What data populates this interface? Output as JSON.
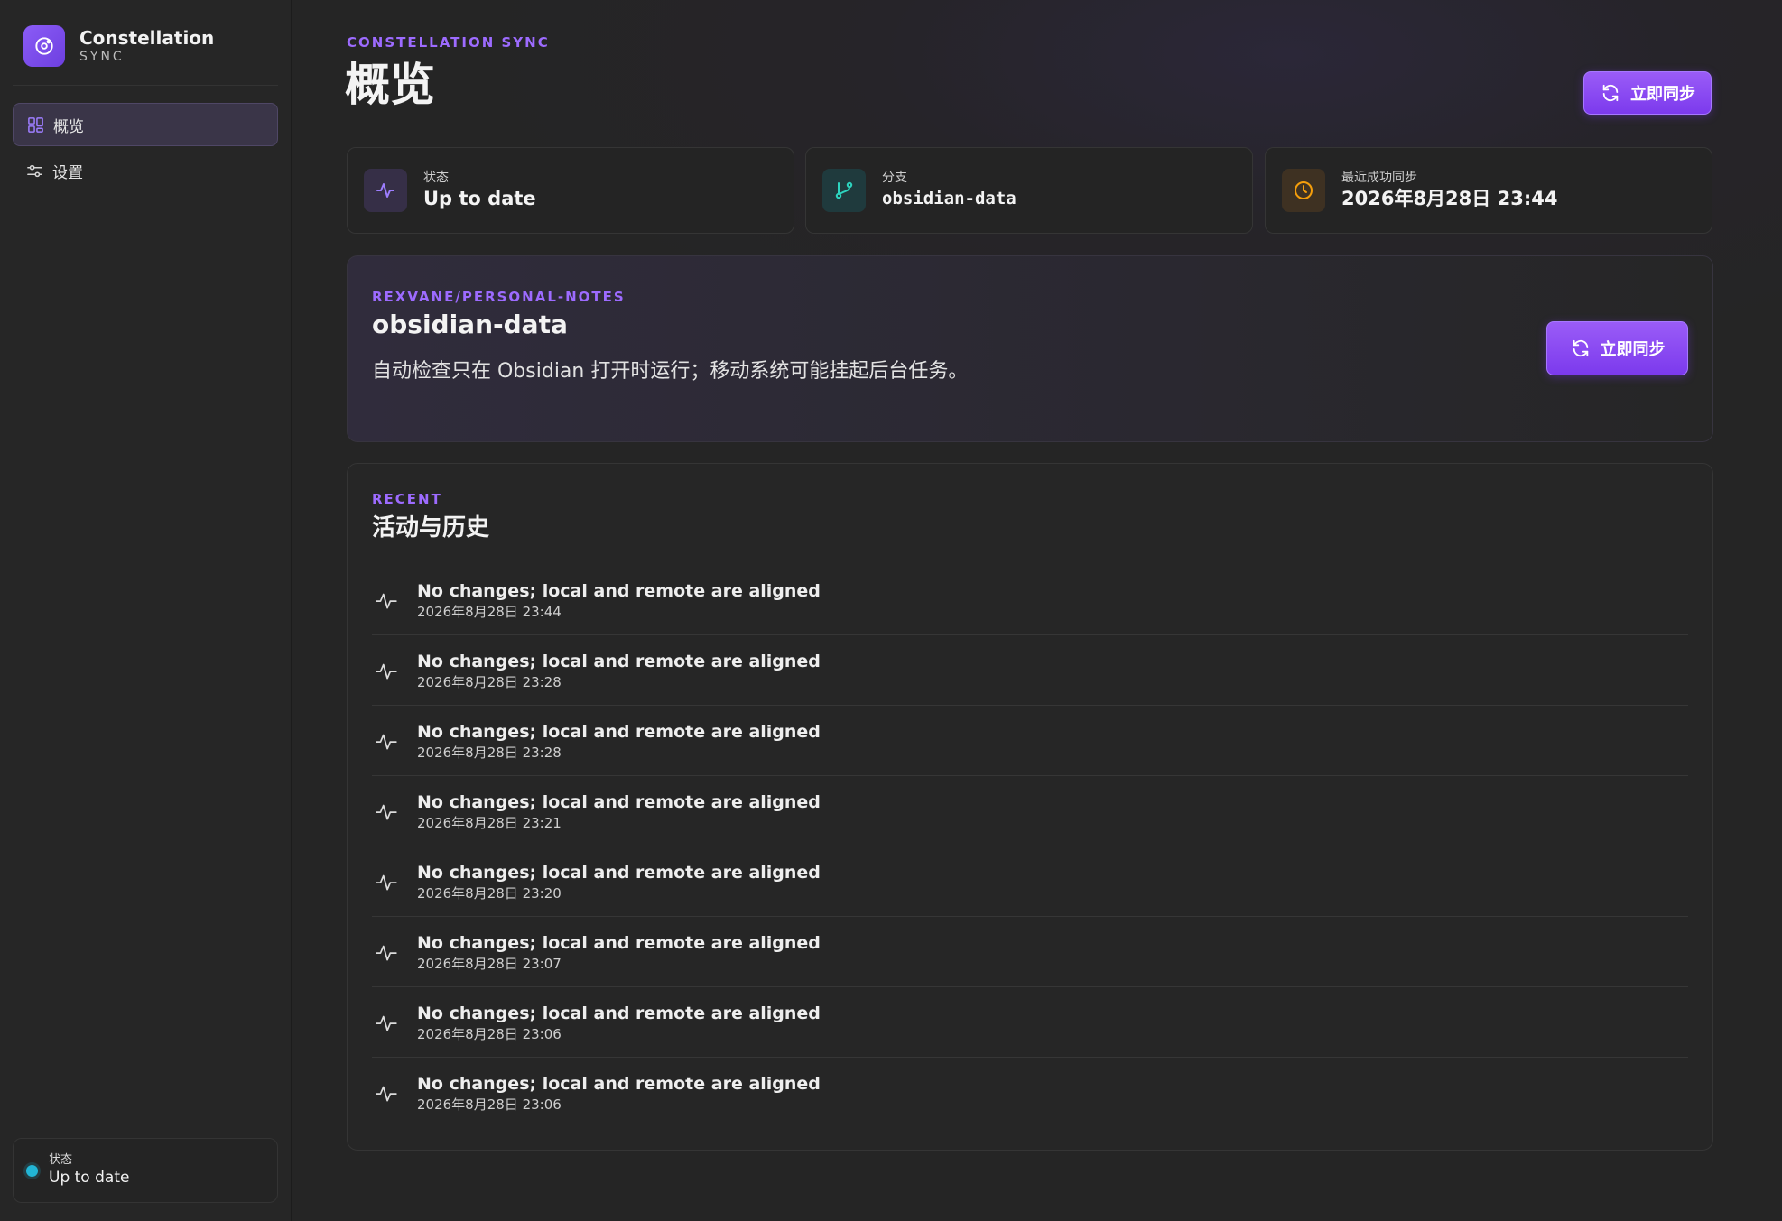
{
  "brand": {
    "name": "Constellation",
    "sub": "SYNC"
  },
  "nav": [
    {
      "label": "概览",
      "icon": "dashboard-grid-icon",
      "active": true
    },
    {
      "label": "设置",
      "icon": "sliders-icon",
      "active": false
    }
  ],
  "sidebar_status": {
    "label": "状态",
    "value": "Up to date",
    "dot_color": "#22b6d6"
  },
  "header": {
    "eyebrow": "CONSTELLATION SYNC",
    "title": "概览",
    "sync_button": "立即同步"
  },
  "stats": [
    {
      "label": "状态",
      "value": "Up to date",
      "icon": "activity-pulse-icon"
    },
    {
      "label": "分支",
      "value": "obsidian-data",
      "icon": "git-branch-icon"
    },
    {
      "label": "最近成功同步",
      "value": "2026年8月28日 23:44",
      "icon": "clock-icon"
    }
  ],
  "repo": {
    "eyebrow": "REXVANE/PERSONAL-NOTES",
    "title": "obsidian-data",
    "description": "自动检查只在 Obsidian 打开时运行；移动系统可能挂起后台任务。",
    "sync_button": "立即同步"
  },
  "history": {
    "eyebrow": "RECENT",
    "title": "活动与历史",
    "items": [
      {
        "message": "No changes; local and remote are aligned",
        "time": "2026年8月28日 23:44"
      },
      {
        "message": "No changes; local and remote are aligned",
        "time": "2026年8月28日 23:28"
      },
      {
        "message": "No changes; local and remote are aligned",
        "time": "2026年8月28日 23:28"
      },
      {
        "message": "No changes; local and remote are aligned",
        "time": "2026年8月28日 23:21"
      },
      {
        "message": "No changes; local and remote are aligned",
        "time": "2026年8月28日 23:20"
      },
      {
        "message": "No changes; local and remote are aligned",
        "time": "2026年8月28日 23:07"
      },
      {
        "message": "No changes; local and remote are aligned",
        "time": "2026年8月28日 23:06"
      },
      {
        "message": "No changes; local and remote are aligned",
        "time": "2026年8月28日 23:06"
      }
    ]
  },
  "colors": {
    "accent": "#9d6bff",
    "button": "#8b4cf4",
    "status_dot": "#22b6d6",
    "clock": "#f59e0b",
    "branch": "#2dd4bf"
  }
}
